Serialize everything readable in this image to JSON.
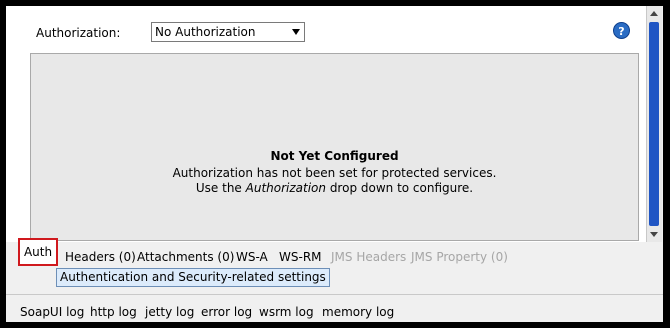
{
  "authorization": {
    "label": "Authorization:",
    "selected": "No Authorization"
  },
  "config": {
    "title": "Not Yet Configured",
    "line1": "Authorization has not been set for protected services.",
    "line2_pre": "Use the ",
    "line2_em": "Authorization",
    "line2_post": " drop down to configure."
  },
  "tabs": {
    "auth": "Auth",
    "headers": "Headers (0)",
    "attachments": "Attachments (0)",
    "wsa": "WS-A",
    "wsrm": "WS-RM",
    "jms_headers": "JMS Headers",
    "jms_property": "JMS Property (0)"
  },
  "tooltip": "Authentication and Security-related settings",
  "logs": [
    "SoapUI log",
    "http log",
    "jetty log",
    "error log",
    "wsrm log",
    "memory log"
  ],
  "colors": {
    "highlight": "#d0191e",
    "scroll_thumb": "#1f55c4",
    "tooltip_bg": "#dcebfb",
    "disabled_text": "#a6a6a6"
  },
  "icons": {
    "help": "help-icon"
  }
}
